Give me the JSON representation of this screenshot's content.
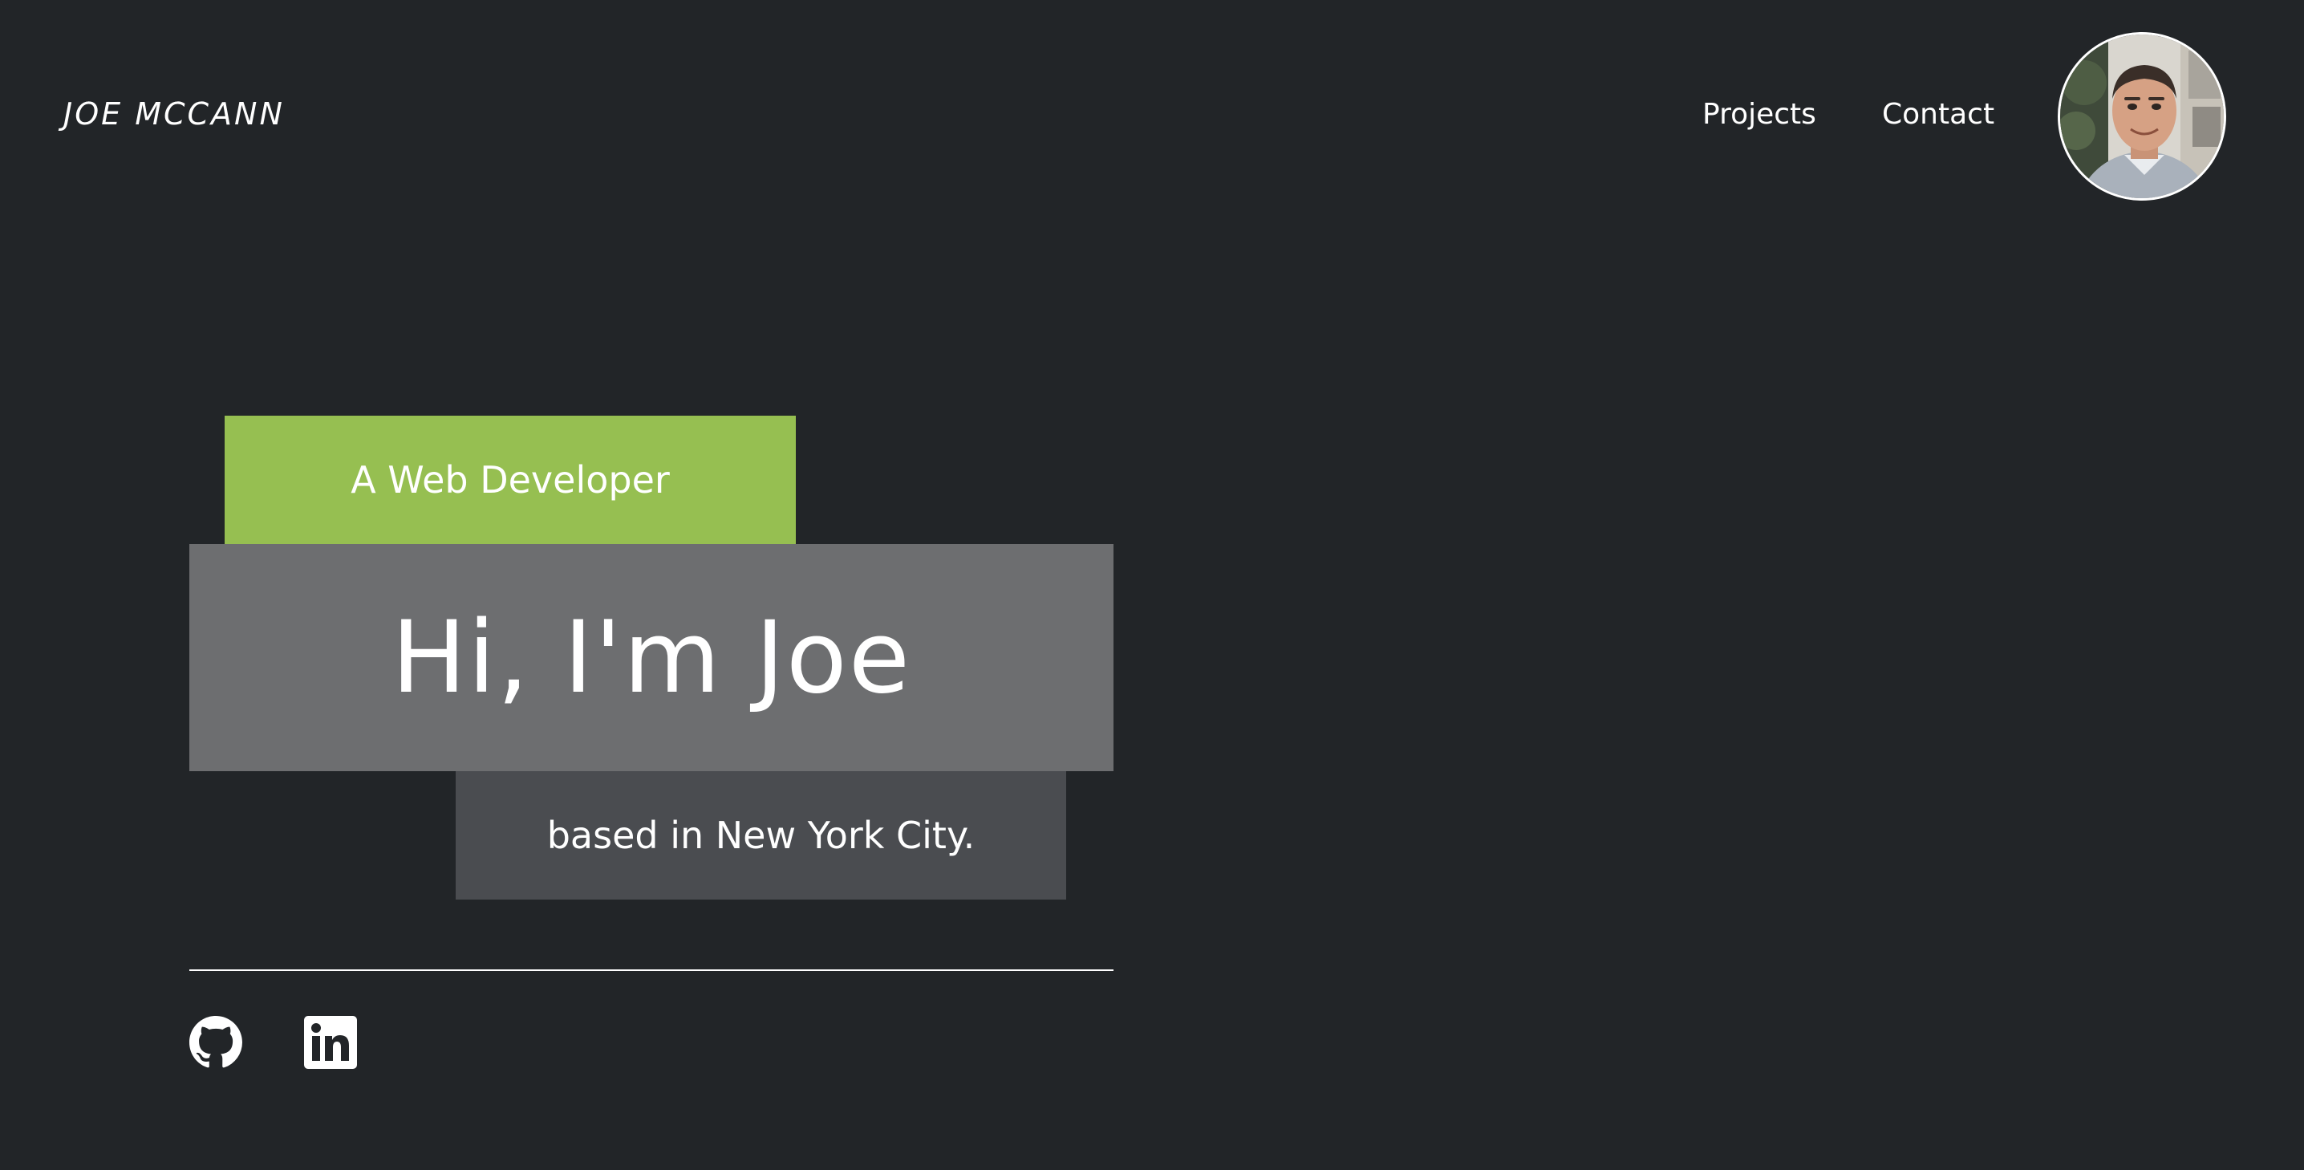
{
  "header": {
    "brand": "JOE MCCANN",
    "nav": [
      {
        "label": "Projects"
      },
      {
        "label": "Contact"
      }
    ],
    "avatar_alt": "Joe McCann"
  },
  "hero": {
    "tagline": "A Web Developer",
    "headline": "Hi, I'm Joe",
    "location": "based in New York City."
  },
  "social": [
    {
      "icon": "github-icon"
    },
    {
      "icon": "linkedin-icon"
    }
  ],
  "colors": {
    "background": "#222528",
    "accent_green": "#96bf51",
    "headline_box": "#6d6e70",
    "location_box": "#4a4c50",
    "text": "#ffffff"
  }
}
